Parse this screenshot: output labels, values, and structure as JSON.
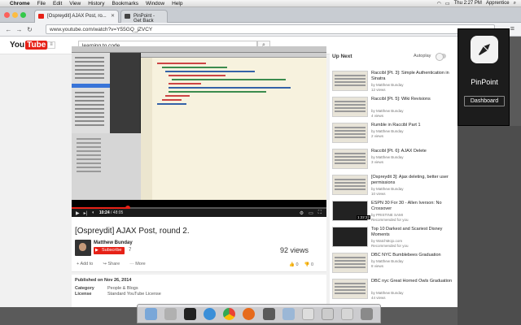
{
  "menubar": {
    "app": "Chrome",
    "items": [
      "File",
      "Edit",
      "View",
      "History",
      "Bookmarks",
      "Window",
      "Help"
    ],
    "right": {
      "clock": "Thu 2:27 PM",
      "user": "Apprentice"
    }
  },
  "browser": {
    "tabs": [
      {
        "label": "[Ospreydit] AJAX Post, ro...",
        "active": true
      },
      {
        "label": "PinPoint - Get Back",
        "active": false
      }
    ],
    "url": "www.youtube.com/watch?v=Y55GQ_jZVCY"
  },
  "youtube": {
    "logo": "You",
    "logo_tube": "Tube",
    "search_value": "learning to code",
    "player": {
      "time_current": "10:24",
      "time_total": "48:05",
      "progress_fraction": 0.22
    },
    "video": {
      "title": "[Ospreydit] AJAX Post, round 2.",
      "channel": "Matthew Bunday",
      "subscribe_label": "Subscribe",
      "subscriber_count": "7",
      "views": "92 views",
      "actions": [
        "Add to",
        "Share",
        "More"
      ],
      "likes": "0",
      "dislikes": "0"
    },
    "description": {
      "published": "Published on Nov 26, 2014",
      "rows": [
        {
          "label": "Category",
          "value": "People & Blogs"
        },
        {
          "label": "License",
          "value": "Standard YouTube License"
        }
      ]
    },
    "up_next": {
      "header": "Up Next",
      "autoplay_label": "Autoplay",
      "items": [
        {
          "title": "Raccibl [Pt. 3]: Simple Authentication in Sinatra",
          "by": "by Matthew Bunday",
          "count": "12 views",
          "duration": ""
        },
        {
          "title": "Raccibl [Pt. 5]: Wiki Revisions",
          "by": "by Matthew Bunday",
          "count": "4 views",
          "duration": ""
        },
        {
          "title": "Rumble in Raccibl Part 1",
          "by": "by Matthew Bunday",
          "count": "2 views",
          "duration": ""
        },
        {
          "title": "Raccibl [Pt. 6]: AJAX Delete",
          "by": "by Matthew Bunday",
          "count": "3 views",
          "duration": ""
        },
        {
          "title": "[Ospreydit 3]: Ajax deleting, better user permissions",
          "by": "by Matthew Bunday",
          "count": "10 views",
          "duration": ""
        },
        {
          "title": "ESPN 30 For 30 - Allen Iverson: No Crossover",
          "by": "by PRISTINE SAMI",
          "count": "Recommended for you",
          "duration": "1:22:22"
        },
        {
          "title": "Top 10 Darkest and Scariest Disney Moments",
          "by": "by WatchMojo.com",
          "count": "Recommended for you",
          "duration": ""
        },
        {
          "title": "DBC NYC Bumblebees Graduation",
          "by": "by Matthew Bunday",
          "count": "8 views",
          "duration": ""
        },
        {
          "title": "DBC nyc Great Horned Owls Graduation",
          "by": "by Matthew Bunday",
          "count": "44 views",
          "duration": ""
        }
      ]
    }
  },
  "pinpoint": {
    "title": "PinPoint",
    "dashboard_label": "Dashboard"
  },
  "colors": {
    "youtube_red": "#e62117",
    "pinpoint_bg": "#1c1c1c"
  }
}
